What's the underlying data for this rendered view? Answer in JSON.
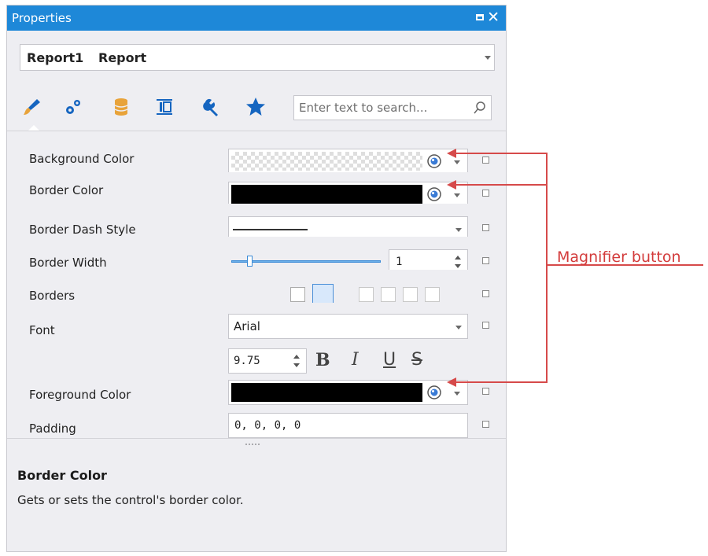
{
  "window": {
    "title": "Properties"
  },
  "object_selector": {
    "name": "Report1",
    "type": "Report"
  },
  "tabs": [
    {
      "icon": "paintbrush-icon"
    },
    {
      "icon": "gears-icon"
    },
    {
      "icon": "database-icon"
    },
    {
      "icon": "layout-icon"
    },
    {
      "icon": "wrench-icon"
    },
    {
      "icon": "star-icon"
    }
  ],
  "search": {
    "placeholder": "Enter text to search..."
  },
  "properties": [
    {
      "label": "Background Color",
      "editor": "color",
      "value_style": "transparent"
    },
    {
      "label": "Border Color",
      "editor": "color",
      "value_style": "black"
    },
    {
      "label": "Border Dash Style",
      "editor": "dash"
    },
    {
      "label": "Border Width",
      "editor": "slider",
      "value": "1"
    },
    {
      "label": "Borders",
      "editor": "borders"
    },
    {
      "label": "Font",
      "editor": "font",
      "value": "Arial",
      "size": "9.75",
      "styles": [
        "B",
        "I",
        "U",
        "S"
      ]
    },
    {
      "label": "Foreground Color",
      "editor": "color",
      "value_style": "black"
    },
    {
      "label": "Padding",
      "editor": "text",
      "value": "0, 0, 0, 0"
    }
  ],
  "description": {
    "title": "Border Color",
    "text": "Gets or sets the control's border color."
  },
  "annotation": {
    "label": "Magnifier button",
    "color": "#d33b3b"
  },
  "colors": {
    "accent": "#1e88d8",
    "star": "#1565c0",
    "database": "#e8a33a"
  }
}
